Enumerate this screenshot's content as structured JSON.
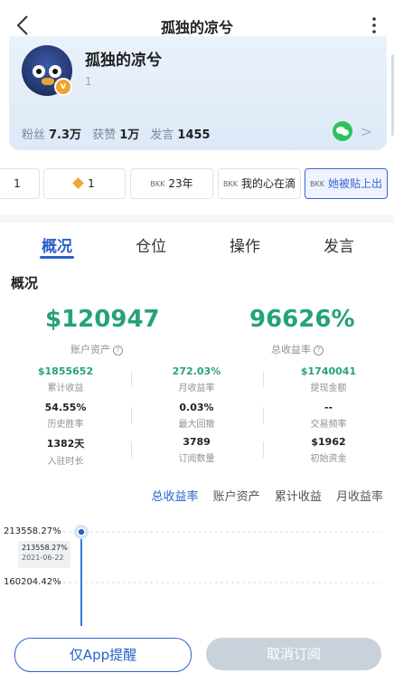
{
  "header": {
    "title": "孤独的凉兮"
  },
  "profile": {
    "name": "孤独的凉兮",
    "level": "1",
    "badge": "v",
    "stats": [
      {
        "label": "粉丝",
        "value": "7.3万"
      },
      {
        "label": "获赞",
        "value": "1万"
      },
      {
        "label": "发言",
        "value": "1455"
      }
    ]
  },
  "tags": [
    {
      "label": "1"
    },
    {
      "label": "1"
    },
    {
      "icon_text": "BKK",
      "label": "23年"
    },
    {
      "icon_text": "BKK",
      "label": "我的心在滴"
    },
    {
      "icon_text": "BKK",
      "label": "她被贴上出"
    }
  ],
  "tabs": [
    "概况",
    "仓位",
    "操作",
    "发言"
  ],
  "overview": {
    "section_title": "概况",
    "assets_value": "$120947",
    "assets_label": "账户资产",
    "return_value": "96626%",
    "return_label": "总收益率",
    "metrics": [
      {
        "value": "$1855652",
        "label": "累计收益"
      },
      {
        "value": "272.03%",
        "label": "月收益率"
      },
      {
        "value": "$1740041",
        "label": "提现金额"
      },
      {
        "value": "54.55%",
        "label": "历史胜率"
      },
      {
        "value": "0.03%",
        "label": "最大回撤"
      },
      {
        "value": "--",
        "label": "交易频率"
      },
      {
        "value": "1382天",
        "label": "入驻时长"
      },
      {
        "value": "3789",
        "label": "订阅数量"
      },
      {
        "value": "$1962",
        "label": "初始资金"
      }
    ]
  },
  "metric_tabs": [
    "总收益率",
    "账户资产",
    "累计收益",
    "月收益率"
  ],
  "chart_data": {
    "type": "line",
    "ytick_labels": [
      "213558.27%",
      "160204.42%"
    ],
    "ylim": [
      160204.42,
      213558.27
    ],
    "tooltip": {
      "value": "213558.27%",
      "date": "2021-06-22"
    },
    "series": [
      {
        "x": [
          "2021-06-22"
        ],
        "values": [
          213558.27
        ]
      }
    ],
    "line_color": "#2a7de1"
  },
  "buttons": {
    "app_remind": "仅App提醒",
    "unsubscribe": "取消订阅"
  }
}
